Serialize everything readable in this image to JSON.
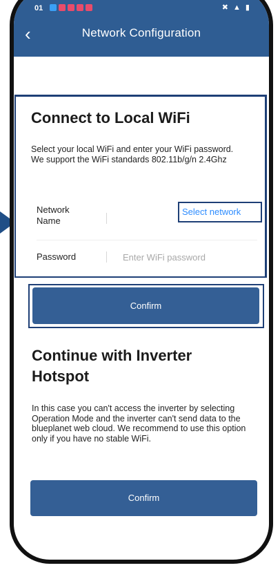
{
  "status_bar": {
    "time": "01",
    "right_icons": "✖ ▲ ▮"
  },
  "nav": {
    "title": "Network Configuration",
    "back_icon": "chevron-left-icon"
  },
  "wifi_section": {
    "title": "Connect to Local WiFi",
    "description": "Select your local WiFi and enter your WiFi password. We support the WiFi standards 802.11b/g/n 2.4Ghz",
    "network_label": "Network Name",
    "select_network": "Select network",
    "password_label": "Password",
    "password_placeholder": "Enter WiFi password",
    "confirm_label": "Confirm"
  },
  "hotspot_section": {
    "title": "Continue with Inverter Hotspot",
    "description": "In this case you can't access the inverter by selecting Operation Mode and the inverter can't send data to the blueplanet web cloud. We recommend to use this option only if you have no stable WiFi.",
    "confirm_label": "Confirm"
  },
  "colors": {
    "header": "#2f5d93",
    "button": "#345f95",
    "highlight": "#1e3f76",
    "link": "#2d8cff"
  }
}
